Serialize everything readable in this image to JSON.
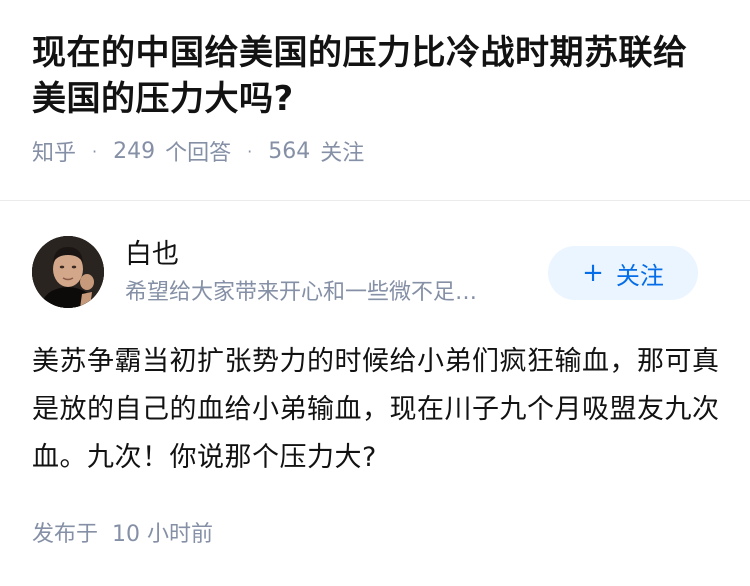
{
  "question": {
    "title": "现在的中国给美国的压力比冷战时期苏联给美国的压力大吗?",
    "source": "知乎",
    "answers_count": "249",
    "answers_label": "个回答",
    "follows_count": "564",
    "follows_label": "关注"
  },
  "author": {
    "name": "白也",
    "bio": "希望给大家带来开心和一些微不足…",
    "follow_icon": "+",
    "follow_label": "关注"
  },
  "answer": {
    "text": "美苏争霸当初扩张势力的时候给小弟们疯狂输血，那可真是放的自己的血给小弟输血，现在川子九个月吸盟友九次血。九次！你说那个压力大?"
  },
  "publish": {
    "label": "发布于",
    "time": "10 小时前"
  },
  "colors": {
    "text": "#121212",
    "meta": "#8590a6",
    "accent": "#056de8",
    "accent_bg": "#ebf5ff",
    "divider": "#ebebeb"
  }
}
